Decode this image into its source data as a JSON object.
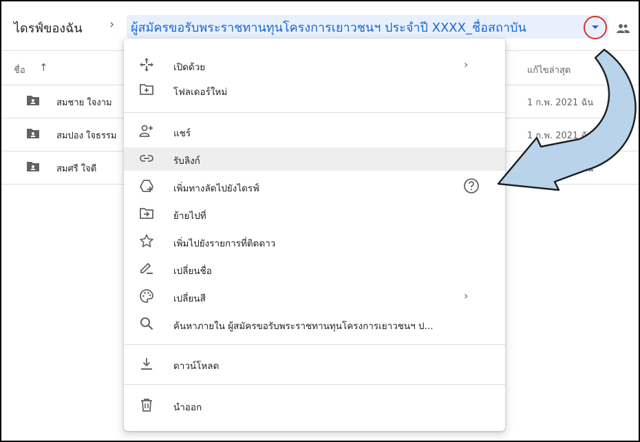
{
  "breadcrumb": {
    "root": "ไดรฟ์ของฉัน",
    "separator": "›",
    "current": "ผู้สมัครขอรับพระราชทานทุนโครงการเยาวชนฯ ประจำปี XXXX_ชื่อสถาบัน"
  },
  "list": {
    "name_header": "ชื่อ",
    "sort_icon": "↑",
    "modified_header": "แก้ไขล่าสุด",
    "rows": [
      {
        "name": "สมชาย ใจงาม",
        "modified": "1 ก.พ. 2021 ฉัน"
      },
      {
        "name": "สมปอง ใจธรรม",
        "modified": "1 ก.พ. 2021 ฉัน"
      },
      {
        "name": "สมศรี ใจดี",
        "modified": "1 ก.พ. 2021 ฉัน"
      }
    ]
  },
  "menu": {
    "items": [
      {
        "label": "เปิดด้วย",
        "icon": "open-with-icon",
        "chevron": "›"
      },
      {
        "label": "โฟลเดอร์ใหม่",
        "icon": "new-folder-icon"
      },
      {
        "label": "แชร์",
        "icon": "share-person-icon"
      },
      {
        "label": "รับลิงก์",
        "icon": "link-icon"
      },
      {
        "label": "เพิ่มทางลัดไปยังไดรฟ์",
        "icon": "add-shortcut-icon"
      },
      {
        "label": "ย้ายไปที่",
        "icon": "move-to-icon"
      },
      {
        "label": "เพิ่มไปยังรายการที่ติดดาว",
        "icon": "star-icon"
      },
      {
        "label": "เปลี่ยนชื่อ",
        "icon": "rename-icon"
      },
      {
        "label": "เปลี่ยนสี",
        "icon": "palette-icon",
        "chevron": "›"
      },
      {
        "label": "ค้นหาภายใน ผู้สมัครขอรับพระราชทานทุนโครงการเยาวชนฯ ป...",
        "icon": "search-icon"
      },
      {
        "label": "ดาวน์โหลด",
        "icon": "download-icon"
      },
      {
        "label": "นำออก",
        "icon": "trash-icon"
      }
    ]
  },
  "colors": {
    "accent": "#1967d2",
    "highlight_circle": "#d93025",
    "annotation_arrow": "#b8d3ea"
  }
}
